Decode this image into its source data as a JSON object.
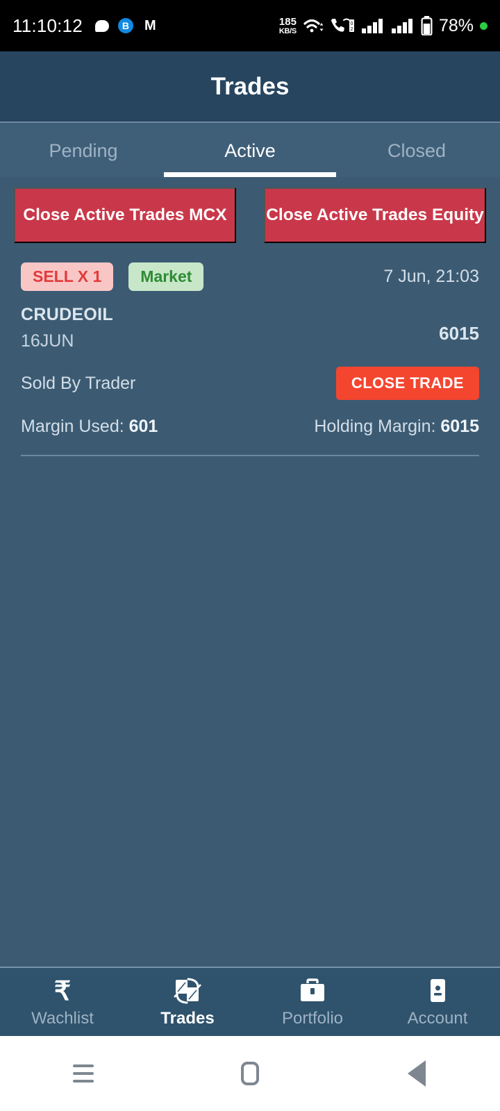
{
  "status_bar": {
    "clock": "11:10:12",
    "left_icons": [
      "chat-bubble-icon",
      "blue-b-badge-icon",
      "m-monogram-icon"
    ],
    "b_badge_label": "B",
    "m_badge_label": "M",
    "network_speed_value": "185",
    "network_speed_unit": "KB/S",
    "sim_label": "2",
    "battery_percent": "78%",
    "icons": [
      "wifi-icon",
      "vowifi-call-icon",
      "signal-sim1-icon",
      "signal-sim2-icon",
      "battery-icon",
      "green-dot-icon"
    ]
  },
  "header": {
    "title": "Trades"
  },
  "tabs": [
    {
      "label": "Pending",
      "active": false
    },
    {
      "label": "Active",
      "active": true
    },
    {
      "label": "Closed",
      "active": false
    }
  ],
  "bulk_actions": [
    {
      "label": "Close Active Trades MCX"
    },
    {
      "label": "Close Active Trades Equity"
    }
  ],
  "trade": {
    "side_badge": "SELL X 1",
    "order_type_badge": "Market",
    "timestamp": "7 Jun, 21:03",
    "symbol": "CRUDEOIL",
    "expiry": "16JUN",
    "price": "6015",
    "status_text": "Sold By Trader",
    "close_button": "CLOSE TRADE",
    "margin_used_label": "Margin Used:",
    "margin_used_value": "601",
    "holding_margin_label": "Holding Margin:",
    "holding_margin_value": "6015"
  },
  "bottom_nav": [
    {
      "label": "Wachlist",
      "icon": "rupee-icon",
      "active": false
    },
    {
      "label": "Trades",
      "icon": "trade-swap-icon",
      "active": true
    },
    {
      "label": "Portfolio",
      "icon": "briefcase-icon",
      "active": false
    },
    {
      "label": "Account",
      "icon": "account-card-icon",
      "active": false
    }
  ],
  "android_nav": [
    "menu-icon",
    "home-icon",
    "back-icon"
  ],
  "colors": {
    "header_bg": "#27455F",
    "body_bg": "#3C5B73",
    "tab_bg": "#3F5F79",
    "bulk_button": "#C9384A",
    "close_trade_button": "#F4452F",
    "sell_badge_bg": "#F9C6C6",
    "sell_badge_text": "#E23B3B",
    "market_badge_bg": "#C8E7C9",
    "market_badge_text": "#2E8B35",
    "bottom_nav_bg": "#2F536D"
  }
}
